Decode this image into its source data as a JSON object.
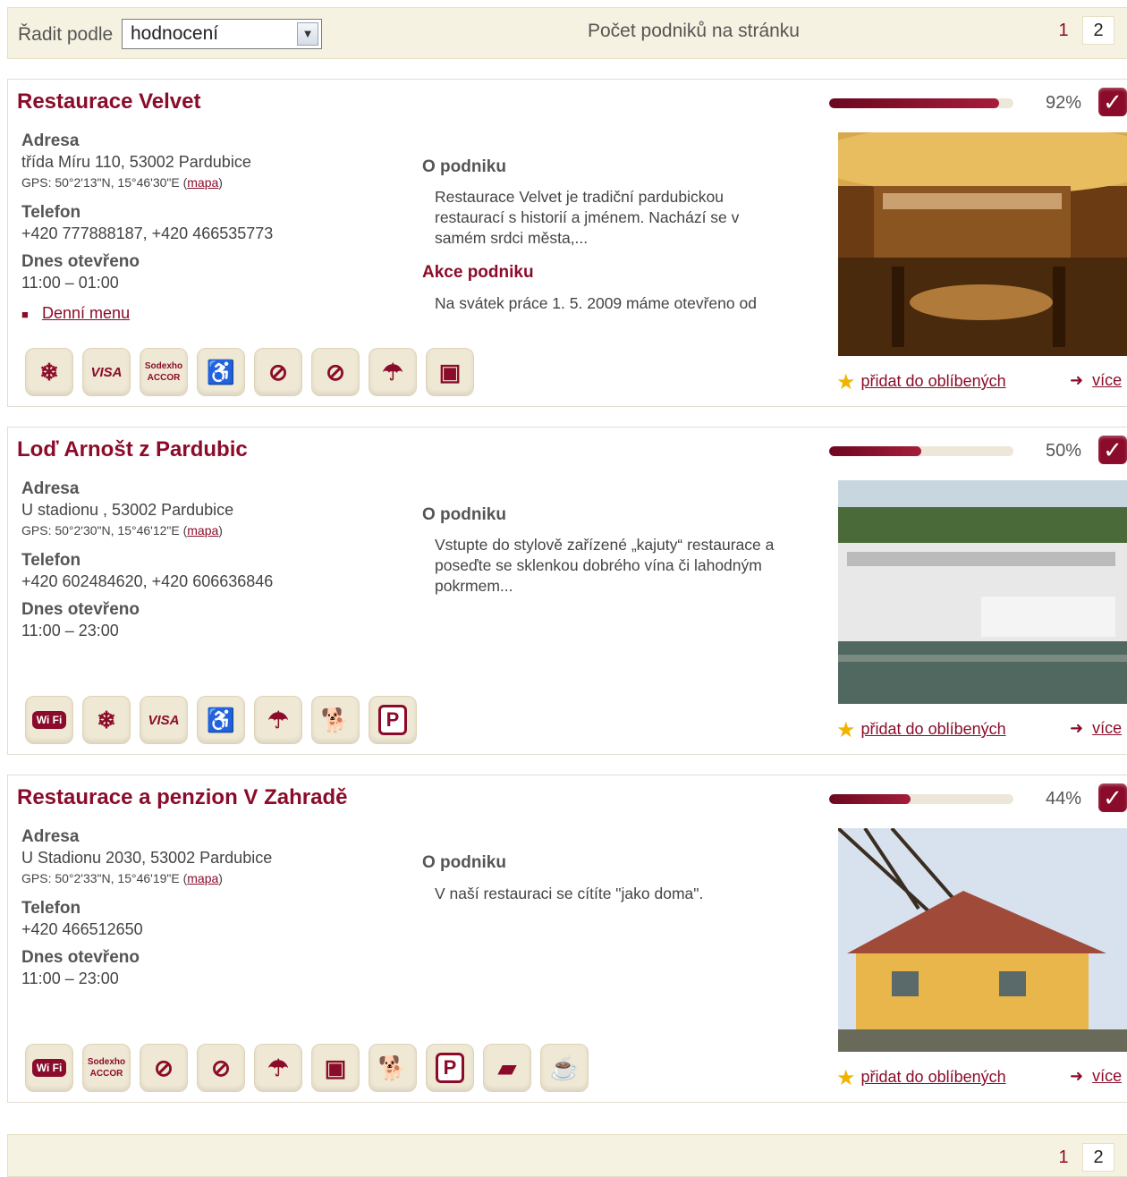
{
  "toolbar": {
    "sort_label": "Řadit podle",
    "sort_value": "hodnocení",
    "per_page_label": "Počet podniků na stránku",
    "pages": [
      "1",
      "2"
    ],
    "current_page": "2"
  },
  "labels": {
    "address": "Adresa",
    "phone": "Telefon",
    "open_today": "Dnes otevřeno",
    "about": "O podniku",
    "events": "Akce podniku",
    "add_favorite": "přidat do oblíbených",
    "more": "více",
    "map": "mapa",
    "daily_menu": "Denní menu"
  },
  "listings": [
    {
      "name": "Restaurace Velvet",
      "address": "třída Míru 110, 53002 Pardubice",
      "gps": "GPS: 50°2'13\"N, 15°46'30\"E",
      "phone": "+420 777888187, +420 466535773",
      "hours": "11:00 – 01:00",
      "about": "Restaurace Velvet je tradiční pardubickou restaurací s historií a jménem. Nachází se v samém srdci města,...",
      "event": "Na svátek práce 1. 5. 2009 máme otevřeno od",
      "rating": 92,
      "rating_text": "92%",
      "features": [
        "snowflake-icon",
        "visa-icon",
        "sodexho-icon",
        "wheelchair-icon",
        "no-smoking-kids-icon",
        "no-smoking-icon",
        "terrace-icon",
        "takeaway-icon"
      ]
    },
    {
      "name": "Loď Arnošt z Pardubic",
      "address": "U stadionu , 53002 Pardubice",
      "gps": "GPS: 50°2'30\"N, 15°46'12\"E",
      "phone": "+420 602484620, +420 606636846",
      "hours": "11:00 – 23:00",
      "about": "Vstupte do stylově zařízené „kajuty“ restaurace a poseďte se sklenkou dobrého vína či lahodným pokrmem...",
      "rating": 50,
      "rating_text": "50%",
      "features": [
        "wifi-icon",
        "snowflake-icon",
        "visa-icon",
        "wheelchair-icon",
        "terrace-icon",
        "dog-icon",
        "parking-icon"
      ]
    },
    {
      "name": "Restaurace a penzion V Zahradě",
      "address": "U Stadionu 2030, 53002 Pardubice",
      "gps": "GPS: 50°2'33\"N, 15°46'19\"E",
      "phone": "+420 466512650",
      "hours": "11:00 – 23:00",
      "about": "V naší restauraci se cítíte \"jako doma\".",
      "rating": 44,
      "rating_text": "44%",
      "features": [
        "wifi-icon",
        "sodexho-icon",
        "no-smoking-kids-icon",
        "no-smoking-icon",
        "terrace-icon",
        "takeaway-icon",
        "dog-icon",
        "parking-icon",
        "book-icon",
        "coffee-icon"
      ]
    }
  ],
  "icon_glyphs": {
    "snowflake-icon": "❄",
    "visa-icon": "VISA",
    "sodexho-icon": "Sodexho",
    "wheelchair-icon": "♿",
    "no-smoking-kids-icon": "⊘",
    "no-smoking-icon": "🚭",
    "terrace-icon": "☂",
    "takeaway-icon": "▣",
    "wifi-icon": "Wi Fi",
    "dog-icon": "🐕",
    "parking-icon": "P",
    "book-icon": "▰",
    "coffee-icon": "☕"
  }
}
